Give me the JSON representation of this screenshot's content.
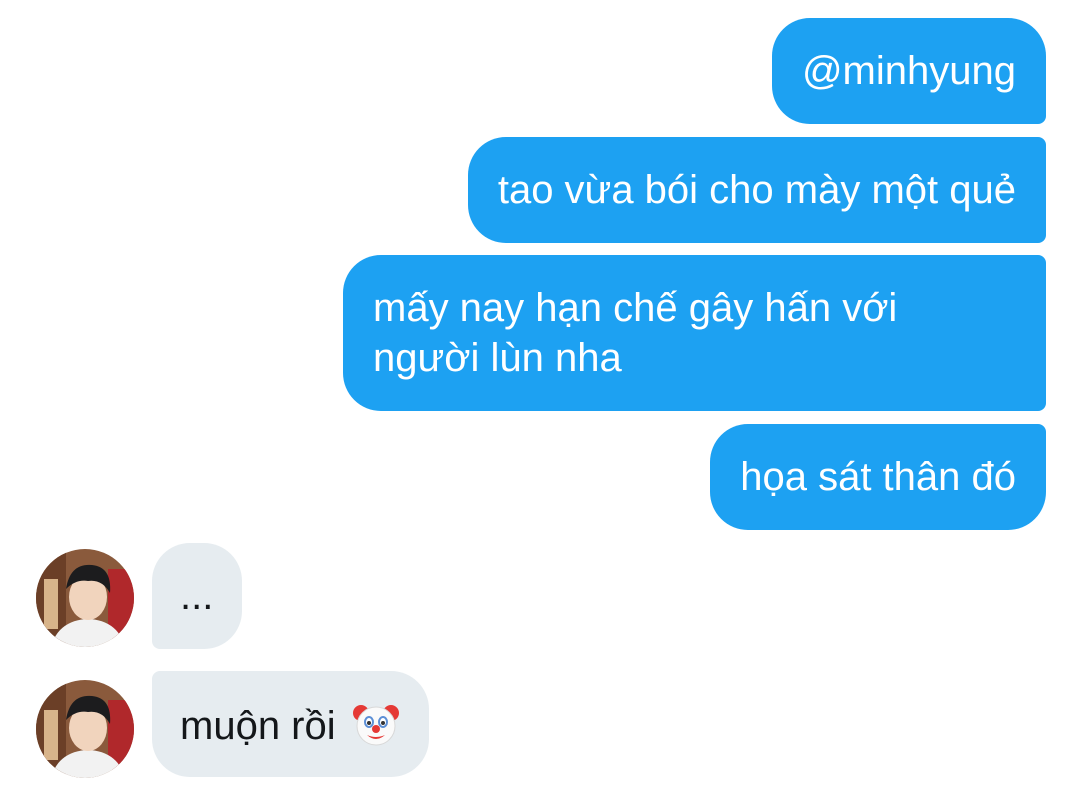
{
  "messages": {
    "sent": [
      {
        "text": "@minhyung"
      },
      {
        "text": "tao vừa bói cho mày một quẻ"
      },
      {
        "line1": "mấy nay hạn chế gây hấn với",
        "line2": "người lùn nha"
      },
      {
        "text": "họa sát thân đó"
      }
    ],
    "received": [
      {
        "text": "..."
      },
      {
        "text": "muộn rồi",
        "emoji": "clown-face-icon"
      }
    ]
  },
  "colors": {
    "sent_bubble": "#1da1f2",
    "received_bubble": "#e6ecf0",
    "sent_text": "#ffffff",
    "received_text": "#14171a"
  }
}
